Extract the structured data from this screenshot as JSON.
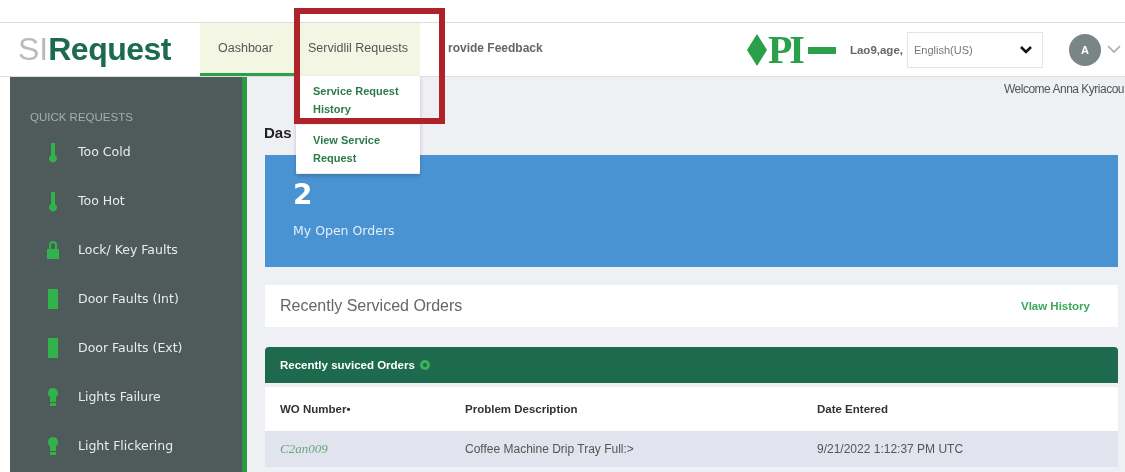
{
  "logo": {
    "light": "SI",
    "dark": "Request"
  },
  "nav": [
    {
      "label": "Oashboar",
      "selected": true,
      "expanded": false
    },
    {
      "label": "Servidlil Requests",
      "selected": false,
      "expanded": true
    },
    {
      "label": "rovide Feedback",
      "selected": false,
      "expanded": false
    }
  ],
  "dropdown": [
    "Service Request History",
    "View Service Request"
  ],
  "brand_logo": {
    "text": "PI"
  },
  "language": {
    "label": "Lao9,age,",
    "value": "English(US)"
  },
  "avatar": {
    "initial": "A"
  },
  "welcome": "Welcome Anna Kyriacou",
  "sidebar": {
    "title": "QUICK REQUESTS",
    "items": [
      {
        "label": "Too Cold",
        "kind": "thermometer"
      },
      {
        "label": "Too Hot",
        "kind": "thermometer"
      },
      {
        "label": "Lock/ Key Faults",
        "kind": "lock"
      },
      {
        "label": "Door Faults (Int)",
        "kind": "door"
      },
      {
        "label": "Door Faults (Ext)",
        "kind": "door"
      },
      {
        "label": "Lights Failure",
        "kind": "bulb"
      },
      {
        "label": "Light Flickering",
        "kind": "bulb"
      }
    ]
  },
  "heading": "Das",
  "stat": {
    "value": "2",
    "label": "My Open Orders"
  },
  "recent": {
    "title": "Recently Serviced Orders",
    "link": "Vlaw History"
  },
  "table": {
    "title": "Recently suviced Orders",
    "columns": [
      "WO Number•",
      "Problem Description",
      "Date Entered"
    ],
    "rows": [
      [
        "C2an009",
        "Coffee Machine Drip Tray Full:>",
        "9/21/2022 1:12:37 PM UTC"
      ]
    ]
  }
}
